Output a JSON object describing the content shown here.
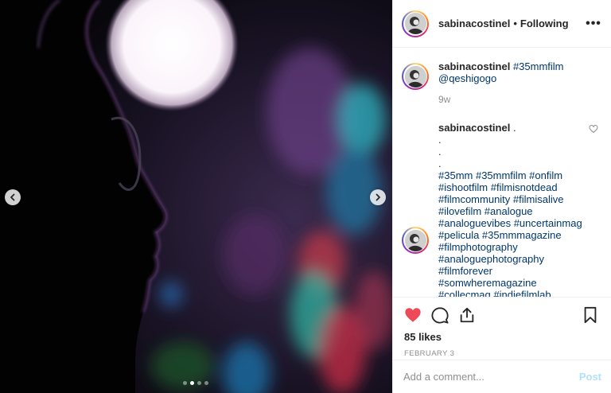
{
  "header": {
    "username": "sabinacostinel",
    "separator": "•",
    "follow_state": "Following",
    "more_label": "•••"
  },
  "caption": {
    "username": "sabinacostinel",
    "hashtag": "#35mmfilm",
    "mention": "@qeshigogo",
    "time": "9w"
  },
  "comment": {
    "username": "sabinacostinel",
    "text": ".",
    "dots": [
      ".",
      ".",
      "."
    ],
    "hashtag_lines": [
      "#35mm #35mmfilm #onfilm",
      "#ishootfilm #filmisnotdead",
      "#filmcommunity #filmisalive",
      "#ilovefilm #analogue",
      "#analoguevibes #uncertainmag",
      "#pelicula #35mmmagazine",
      "#filmphotography",
      "#analoguephotography",
      "#filmforever",
      "#somwheremagazine",
      "#collecmag #indiefilmlab"
    ]
  },
  "likes": "85 likes",
  "date": "FEBRUARY 3",
  "add_comment": {
    "placeholder": "Add a comment...",
    "post_label": "Post"
  },
  "carousel": {
    "total": 4,
    "active_index": 1
  },
  "colors": {
    "like_red": "#ed4956",
    "link_blue": "#00376b",
    "post_disabled": "#b2dffc",
    "muted_gray": "#8e8e8e"
  },
  "icons": [
    "chevron-left-icon",
    "chevron-right-icon",
    "more-icon",
    "heart-icon",
    "comment-icon",
    "share-icon",
    "bookmark-icon",
    "heart-outline-icon"
  ]
}
